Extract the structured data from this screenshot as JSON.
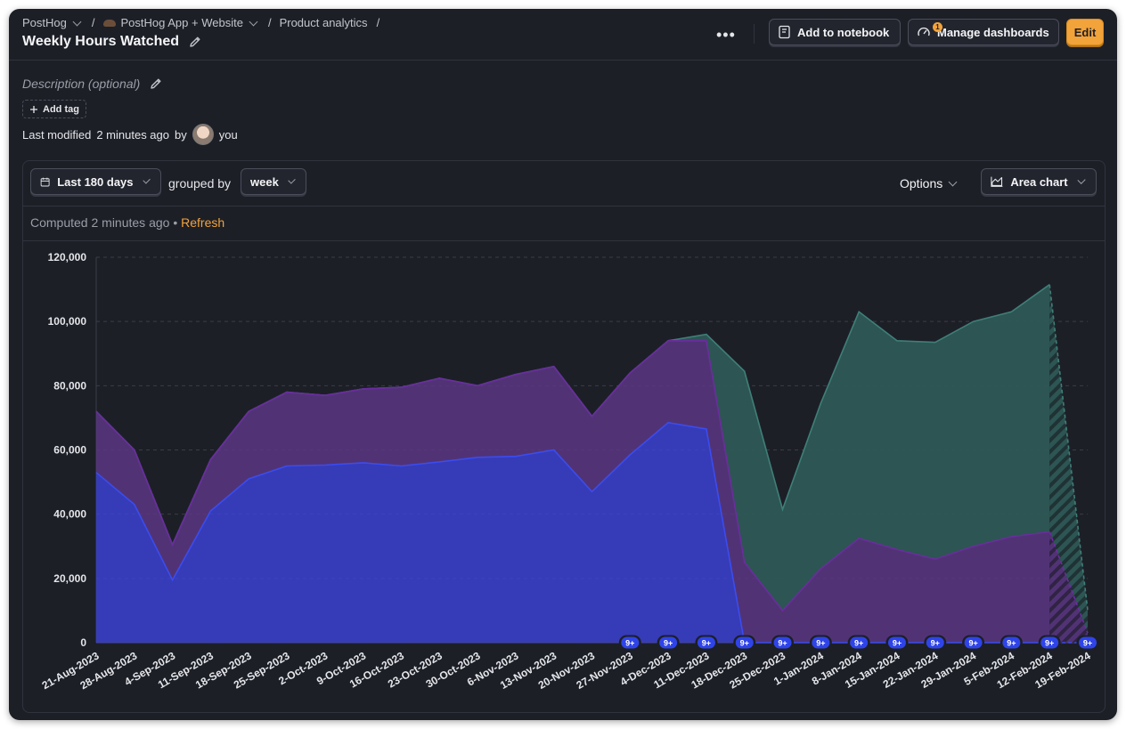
{
  "breadcrumb": {
    "org": "PostHog",
    "project": "PostHog App + Website",
    "section": "Product analytics",
    "separator": "/"
  },
  "title": "Weekly Hours Watched",
  "header": {
    "more_label": "•••",
    "notebook_label": "Add to notebook",
    "dashboards_label": "Manage dashboards",
    "dashboards_badge": "1",
    "edit_label": "Edit"
  },
  "meta": {
    "description_placeholder": "Description (optional)",
    "add_tag_label": "Add tag",
    "modified_prefix": "Last modified",
    "modified_time": "2 minutes ago",
    "modified_by": "by",
    "modified_user": "you"
  },
  "toolbar": {
    "date_range": "Last 180 days",
    "grouped_by_label": "grouped by",
    "interval": "week",
    "options_label": "Options",
    "chart_type_label": "Area chart"
  },
  "computed": {
    "text": "Computed 2 minutes ago",
    "bullet": "•",
    "refresh_label": "Refresh"
  },
  "colors": {
    "blue": "#3d44e0",
    "purple": "#5a3784",
    "teal": "#2f5a57",
    "accent": "#f2a33a"
  },
  "chart_data": {
    "type": "area",
    "stacked": true,
    "ylim": [
      0,
      120000
    ],
    "y_ticks": [
      "0",
      "20,000",
      "40,000",
      "60,000",
      "80,000",
      "100,000",
      "120,000"
    ],
    "y_tick_values": [
      0,
      20000,
      40000,
      60000,
      80000,
      100000,
      120000
    ],
    "x": [
      "21-Aug-2023",
      "28-Aug-2023",
      "4-Sep-2023",
      "11-Sep-2023",
      "18-Sep-2023",
      "25-Sep-2023",
      "2-Oct-2023",
      "9-Oct-2023",
      "16-Oct-2023",
      "23-Oct-2023",
      "30-Oct-2023",
      "6-Nov-2023",
      "13-Nov-2023",
      "20-Nov-2023",
      "27-Nov-2023",
      "4-Dec-2023",
      "11-Dec-2023",
      "18-Dec-2023",
      "25-Dec-2023",
      "1-Jan-2024",
      "8-Jan-2024",
      "15-Jan-2024",
      "22-Jan-2024",
      "29-Jan-2024",
      "5-Feb-2024",
      "12-Feb-2024",
      "19-Feb-2024"
    ],
    "series": [
      {
        "color": "#3d44e0",
        "values": [
          53000,
          43000,
          19500,
          41000,
          51000,
          55000,
          55300,
          56000,
          55000,
          56300,
          57700,
          58000,
          60000,
          47000,
          58500,
          68500,
          66500,
          0,
          0,
          0,
          0,
          0,
          0,
          0,
          0,
          0,
          0
        ]
      },
      {
        "color": "#5a3784",
        "values": [
          19000,
          17000,
          11000,
          16000,
          21000,
          23000,
          21700,
          23000,
          24500,
          26000,
          22300,
          25500,
          26000,
          23500,
          25500,
          25500,
          27500,
          25000,
          10000,
          23000,
          32500,
          29000,
          26000,
          30000,
          33000,
          34500,
          3000
        ]
      },
      {
        "color": "#2f5a57",
        "values": [
          0,
          0,
          0,
          0,
          0,
          0,
          0,
          0,
          0,
          0,
          0,
          0,
          0,
          0,
          0,
          0,
          2000,
          59500,
          31500,
          51500,
          70500,
          65000,
          67500,
          70000,
          70000,
          77000,
          7000
        ]
      }
    ],
    "incomplete_from_index": 25,
    "annotation_label": "9+",
    "annotation_from_index": 14
  }
}
